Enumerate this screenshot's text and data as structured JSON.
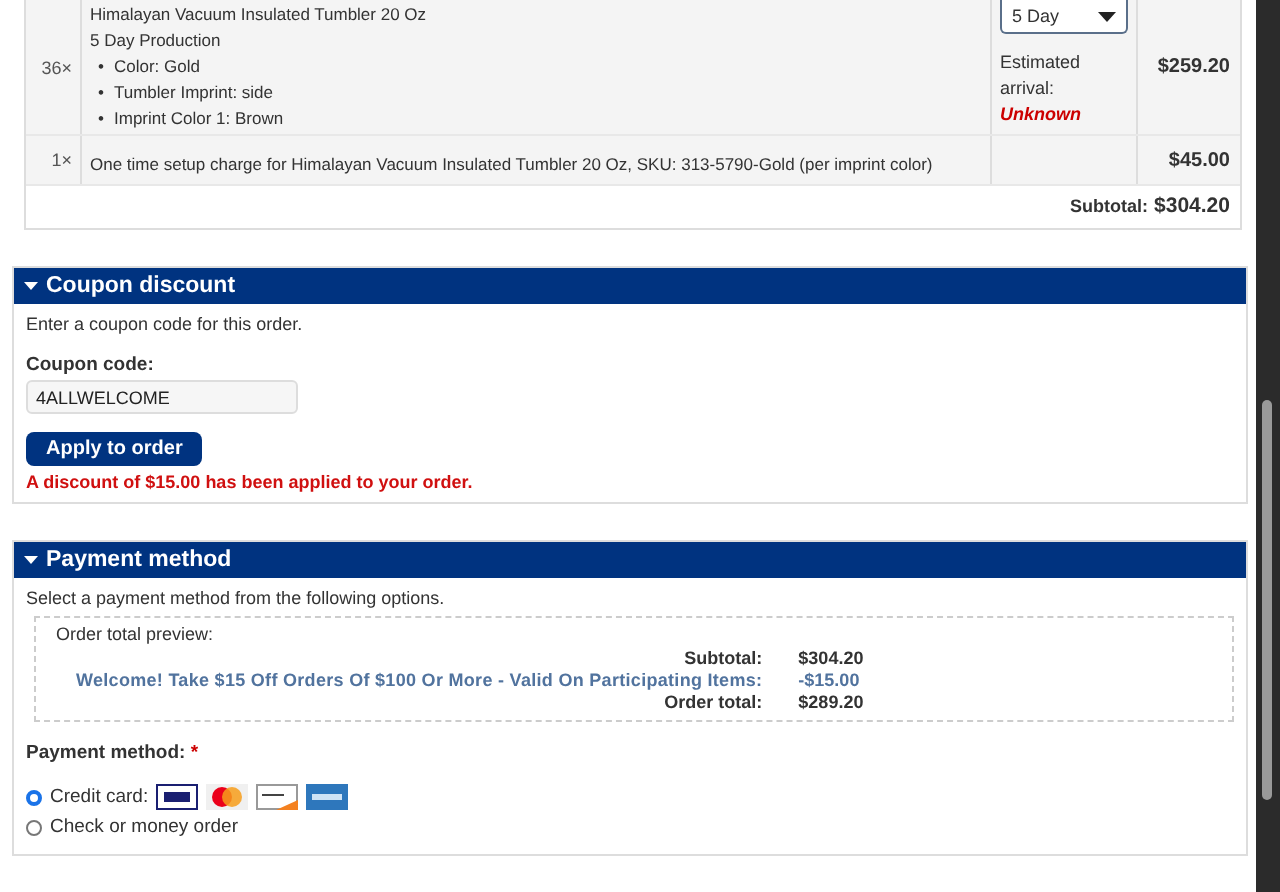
{
  "order_items": [
    {
      "quantity": "36×",
      "title": "Himalayan Vacuum Insulated Tumbler 20 Oz",
      "production": "5 Day Production",
      "attributes": [
        {
          "bullet": "•",
          "text": "Color: Gold"
        },
        {
          "bullet": "•",
          "text": "Tumbler Imprint: side"
        },
        {
          "bullet": "•",
          "text": "Imprint Color 1: Brown"
        }
      ],
      "production_select": "5 Day",
      "arrival_label": "Estimated arrival:",
      "arrival_value": "Unknown",
      "price": "$259.20"
    },
    {
      "quantity": "1×",
      "title": "One time setup charge for Himalayan Vacuum Insulated Tumbler 20 Oz, SKU: 313-5790-Gold (per imprint color)",
      "price": "$45.00"
    }
  ],
  "subtotal": {
    "label": "Subtotal:",
    "value": "$304.20"
  },
  "coupon": {
    "title": "Coupon discount",
    "expanded": true,
    "help": "Enter a coupon code for this order.",
    "label": "Coupon code:",
    "value": "4ALLWELCOME",
    "button": "Apply to order",
    "message": "A discount of $15.00 has been applied to your order."
  },
  "payment": {
    "title": "Payment method",
    "expanded": true,
    "help": "Select a payment method from the following options.",
    "preview": {
      "title": "Order total preview:",
      "lines": [
        {
          "kind": "plain",
          "label": "Subtotal:",
          "value": "$304.20"
        },
        {
          "kind": "discount",
          "label": "Welcome! Take $15 Off Orders Of $100 Or More - Valid On Participating Items:",
          "value": "-$15.00"
        },
        {
          "kind": "plain",
          "label": "Order total:",
          "value": "$289.20"
        }
      ]
    },
    "method_label": "Payment method:",
    "required_mark": "*",
    "methods": [
      {
        "kind": "card",
        "label": "Credit card:",
        "selected": true
      },
      {
        "kind": "plain",
        "label": "Check or money order",
        "selected": false
      }
    ]
  }
}
